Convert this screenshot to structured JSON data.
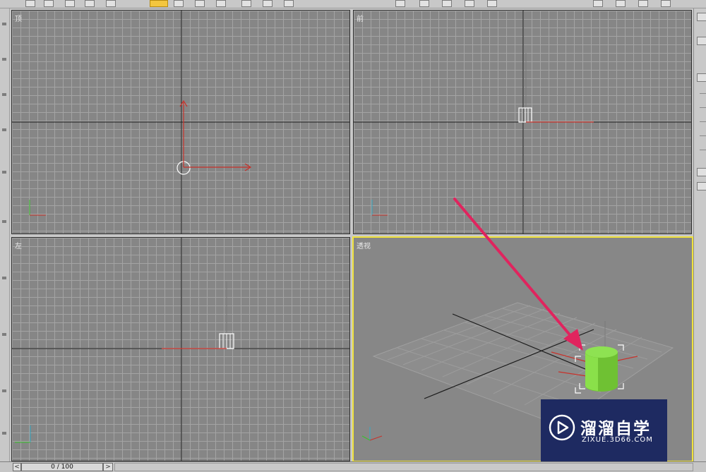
{
  "viewports": {
    "top": {
      "label": "顶"
    },
    "front": {
      "label": "前"
    },
    "left": {
      "label": "左"
    },
    "perspective": {
      "label": "透视"
    }
  },
  "timeline": {
    "frame_display": "0 / 100",
    "prev_symbol": "<",
    "next_symbol": ">"
  },
  "watermark": {
    "title": "溜溜自学",
    "url": "ZIXUE.3D66.COM"
  },
  "colors": {
    "grid_background": "#868686",
    "active_viewport_border": "#f0e23c",
    "axis_red": "#c8322b",
    "object_green": "#7bd13b",
    "annotation_arrow": "#e0245e",
    "watermark_bg": "#1e2a61"
  },
  "icons": {
    "select_tool": "cursor-arrow-icon",
    "watermark_logo": "play-in-circle-icon",
    "annotation": "arrow-annotation"
  }
}
